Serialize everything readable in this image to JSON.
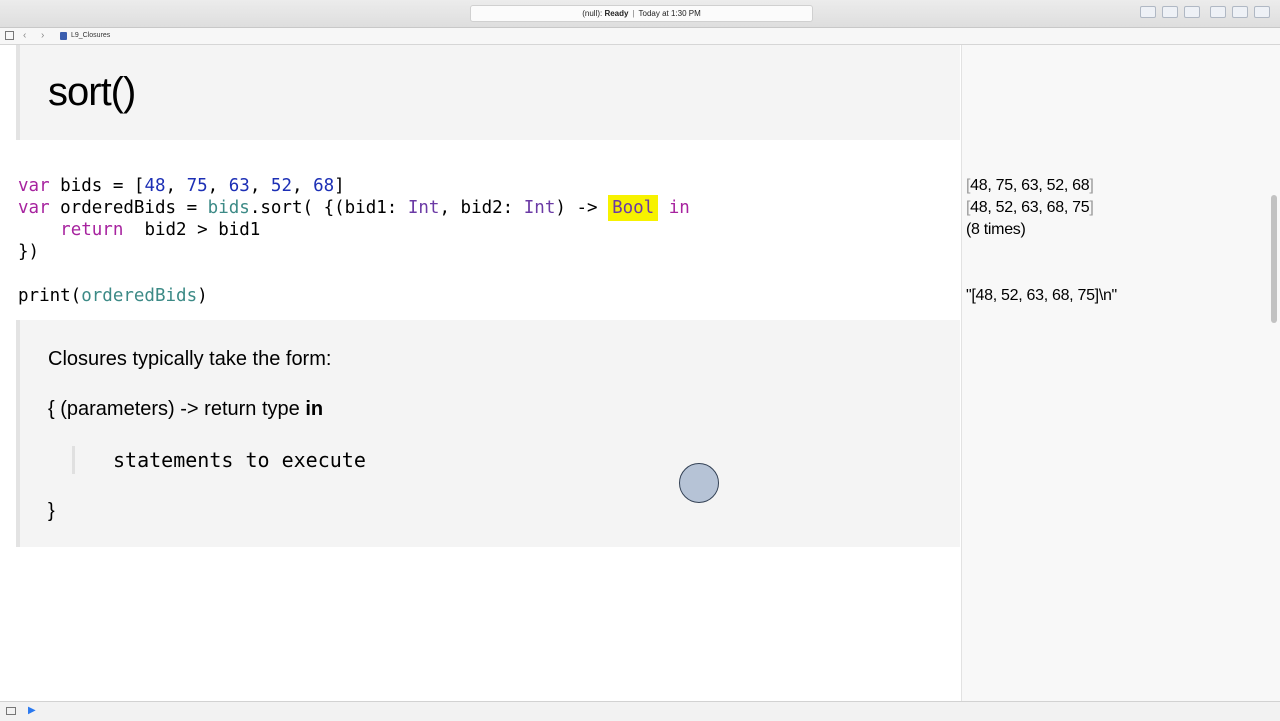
{
  "titlebar": {
    "activity_prefix": "(null): ",
    "activity_status": "Ready",
    "activity_separator": "|",
    "activity_time": "Today at 1:30 PM"
  },
  "jumpbar": {
    "back_icon": "‹",
    "forward_icon": "›",
    "file_name": "L9_Closures"
  },
  "doc": {
    "title": "sort()",
    "form_intro": "Closures typically take the form:",
    "form_open": "{ (parameters) -> return type ",
    "form_in": "in",
    "form_statements": "statements to execute",
    "form_close": "}"
  },
  "code": {
    "line1": {
      "kw": "var",
      "name": " bids = [",
      "n1": "48",
      "c1": ", ",
      "n2": "75",
      "c2": ", ",
      "n3": "63",
      "c3": ", ",
      "n4": "52",
      "c4": ", ",
      "n5": "68",
      "end": "]"
    },
    "line2": {
      "kw": "var",
      "name": " orderedBids = ",
      "ref": "bids",
      "call": ".sort( {(bid1: ",
      "t1": "Int",
      "mid": ", bid2: ",
      "t2": "Int",
      "arrow": ") -> ",
      "ret": "Bool",
      "sp": " ",
      "in": "in"
    },
    "line3": {
      "indent": "    ",
      "kw": "return",
      "expr": "  bid2 > bid1"
    },
    "line4": {
      "text": "})"
    },
    "line5": {
      "fn": "print(",
      "arg": "orderedBids",
      "end": ")"
    }
  },
  "results": {
    "r1": "48, 75, 63, 52, 68",
    "r2": "48, 52, 63, 68, 75",
    "r3": "(8 times)",
    "r4": "\"[48, 52, 63, 68, 75]\\n\""
  },
  "bottombar": {
    "run_icon": "▶"
  }
}
